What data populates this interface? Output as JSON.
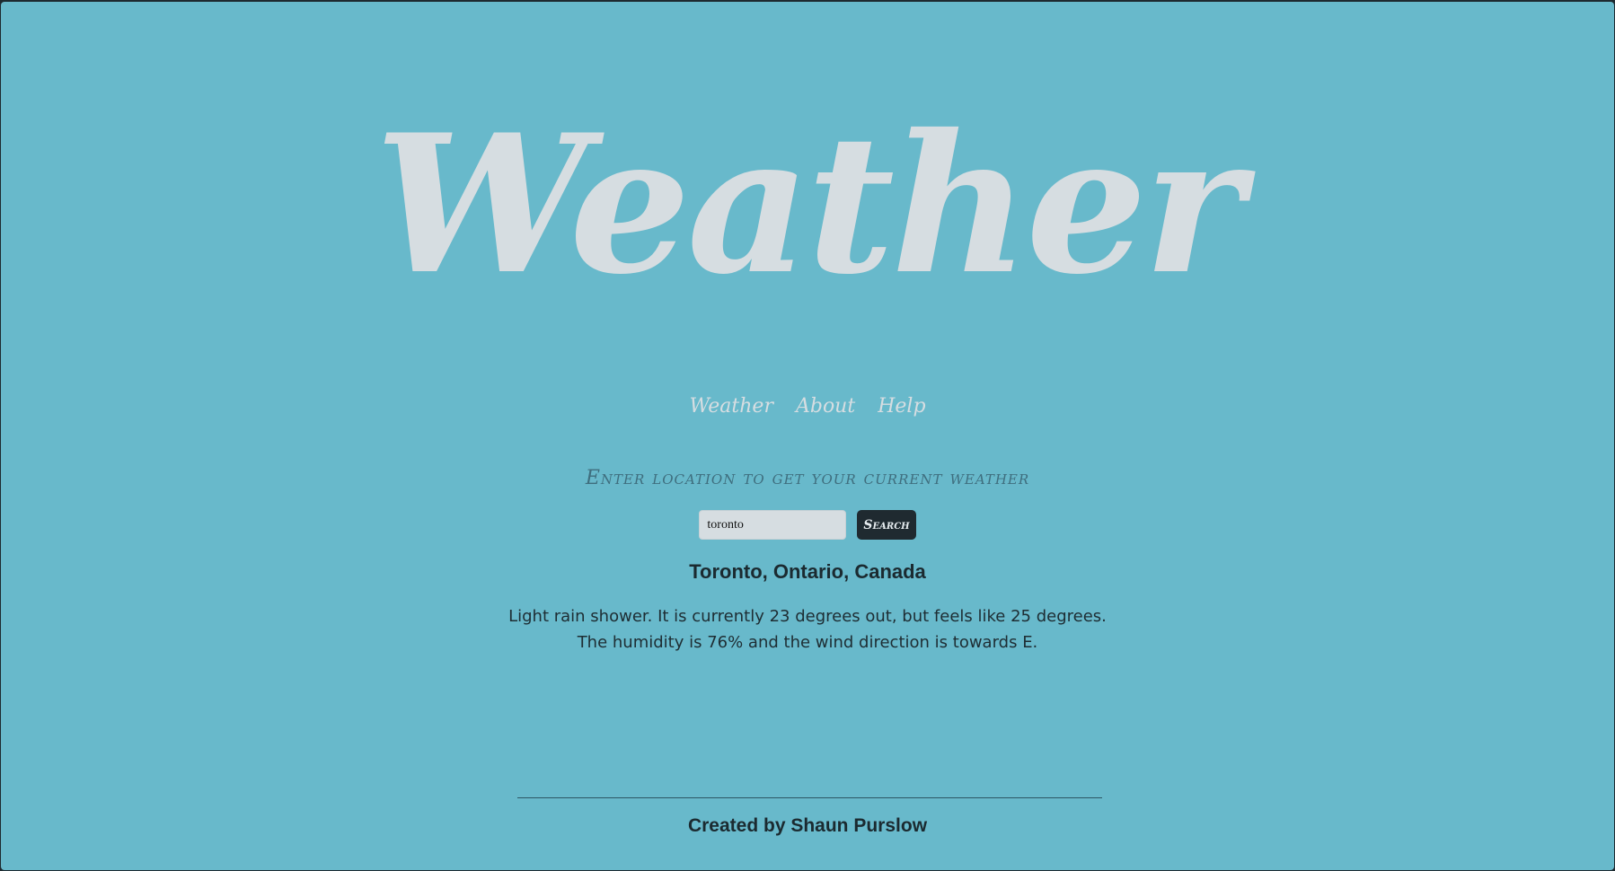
{
  "header": {
    "title": "Weather"
  },
  "nav": {
    "items": [
      {
        "label": "Weather"
      },
      {
        "label": "About"
      },
      {
        "label": "Help"
      }
    ]
  },
  "search": {
    "prompt": "Enter location to get your current weather",
    "input_value": "toronto",
    "button_label": "Search"
  },
  "result": {
    "location": "Toronto, Ontario, Canada",
    "forecast_line1": "Light rain shower. It is currently 23 degrees out, but feels like 25 degrees.",
    "forecast_line2": "The humidity is 76% and the wind direction is towards E."
  },
  "footer": {
    "credit": "Created by Shaun Purslow"
  },
  "colors": {
    "background": "#68b9cb",
    "title_text": "#d6dde1",
    "button_background": "#1f2a30",
    "body_text": "#1b2a30"
  }
}
